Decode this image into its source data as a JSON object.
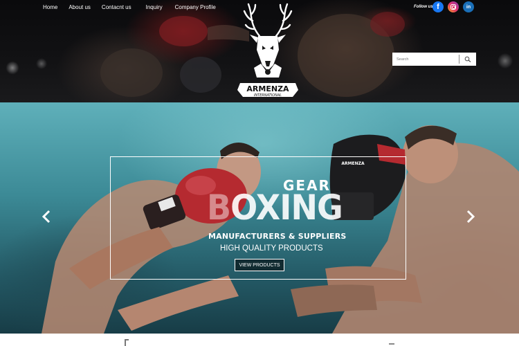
{
  "nav": {
    "items": [
      {
        "label": "Home"
      },
      {
        "label": "About us"
      },
      {
        "label": "Contacnt us"
      },
      {
        "label": "Inquiry"
      },
      {
        "label": "Company  Profile"
      }
    ]
  },
  "social": {
    "follow_label": "Follow us",
    "links": [
      {
        "icon": "facebook-icon",
        "glyph": "f",
        "color": "#1877f2"
      },
      {
        "icon": "instagram-icon",
        "color": "#e1306c"
      },
      {
        "icon": "linkedin-icon",
        "glyph": "in",
        "color": "#1a6fb8"
      }
    ]
  },
  "search": {
    "placeholder": "Search",
    "icon": "search-icon"
  },
  "logo": {
    "brand": "ARMENZA",
    "tagline": "INTERNATIONAL",
    "icon": "stag-head-logo"
  },
  "hero": {
    "gear": "GEAR",
    "boxing_first": "B",
    "boxing_rest": "OXING",
    "manufacturers": "MANUFACTURERS & SUPPLIERS",
    "quality": "HIGH QUALITY PRODUCTS",
    "button_label": "VIEW PRODUCTS",
    "glove_brand": "ARMENZA",
    "prev_icon": "chevron-left-icon",
    "next_icon": "chevron-right-icon"
  },
  "colors": {
    "facebook": "#1877f2",
    "linkedin": "#1a6fb8",
    "glove_red": "#b52a30"
  }
}
